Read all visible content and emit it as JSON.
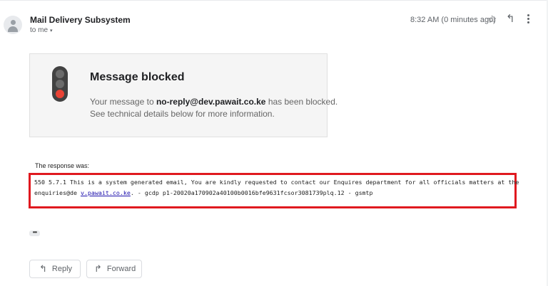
{
  "header": {
    "sender": "Mail Delivery Subsystem",
    "recipient_label": "to me",
    "recipient_caret": "▾",
    "timestamp": "8:32 AM (0 minutes ago)",
    "icons": {
      "avatar": "person-avatar-icon",
      "star": "☆",
      "reply": "↰",
      "more": "more-vert-icon"
    }
  },
  "notice": {
    "title": "Message blocked",
    "line1_prefix": "Your message to ",
    "line1_email": "no-reply@dev.pawait.co.ke",
    "line1_suffix": " has been blocked.",
    "line2": "See technical details below for more information.",
    "icon": "traffic-light-icon"
  },
  "response": {
    "label": "The response was:",
    "line1": "550 5.7.1 This is a system generated email, You are kindly requested to contact our Enquires department for all officials matters at the",
    "line2_prefix": "enquiries@de ",
    "line2_link": "v.pawait.co.ke",
    "line2_suffix": ". - gcdp p1-20020a170902a40100b0016bfe9631fcsor3081739plq.12 - gsmtp"
  },
  "trimmed_content": "•••",
  "actions": {
    "reply_label": "Reply",
    "reply_icon": "↰",
    "forward_label": "Forward",
    "forward_icon": "↱"
  },
  "colors": {
    "highlight_border": "#e0191f",
    "stop_light": "#ea4335",
    "link": "#1a0dab"
  }
}
